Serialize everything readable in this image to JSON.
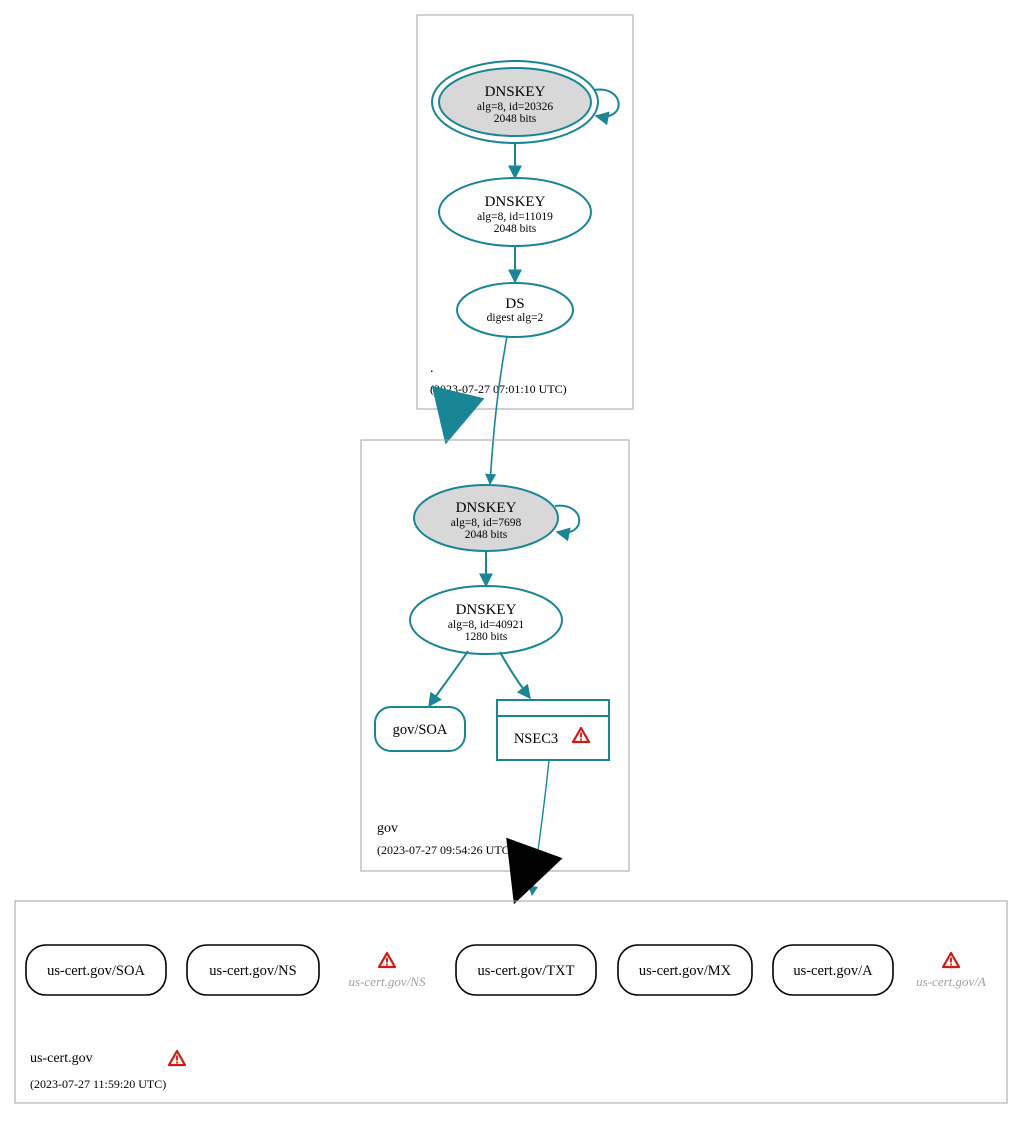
{
  "colors": {
    "teal": "#1a8595",
    "gray_fill": "#d8d8d8",
    "box_gray": "#a0a0a0",
    "black": "#000000",
    "warn_red": "#cc1b12",
    "warn_fill": "#f7f7f7"
  },
  "zones": {
    "root": {
      "label": ".",
      "timestamp": "(2023-07-27 07:01:10 UTC)",
      "ksk": {
        "title": "DNSKEY",
        "line1": "alg=8, id=20326",
        "line2": "2048 bits"
      },
      "zsk": {
        "title": "DNSKEY",
        "line1": "alg=8, id=11019",
        "line2": "2048 bits"
      },
      "ds": {
        "title": "DS",
        "line1": "digest alg=2"
      }
    },
    "gov": {
      "label": "gov",
      "timestamp": "(2023-07-27 09:54:26 UTC)",
      "ksk": {
        "title": "DNSKEY",
        "line1": "alg=8, id=7698",
        "line2": "2048 bits"
      },
      "zsk": {
        "title": "DNSKEY",
        "line1": "alg=8, id=40921",
        "line2": "1280 bits"
      },
      "soa": {
        "label": "gov/SOA"
      },
      "nsec3": {
        "label": "NSEC3"
      }
    },
    "uscert": {
      "label": "us-cert.gov",
      "timestamp": "(2023-07-27 11:59:20 UTC)",
      "rr_soa": {
        "label": "us-cert.gov/SOA"
      },
      "rr_ns": {
        "label": "us-cert.gov/NS"
      },
      "rr_ns_g": {
        "label": "us-cert.gov/NS"
      },
      "rr_txt": {
        "label": "us-cert.gov/TXT"
      },
      "rr_mx": {
        "label": "us-cert.gov/MX"
      },
      "rr_a": {
        "label": "us-cert.gov/A"
      },
      "rr_a_g": {
        "label": "us-cert.gov/A"
      }
    }
  }
}
